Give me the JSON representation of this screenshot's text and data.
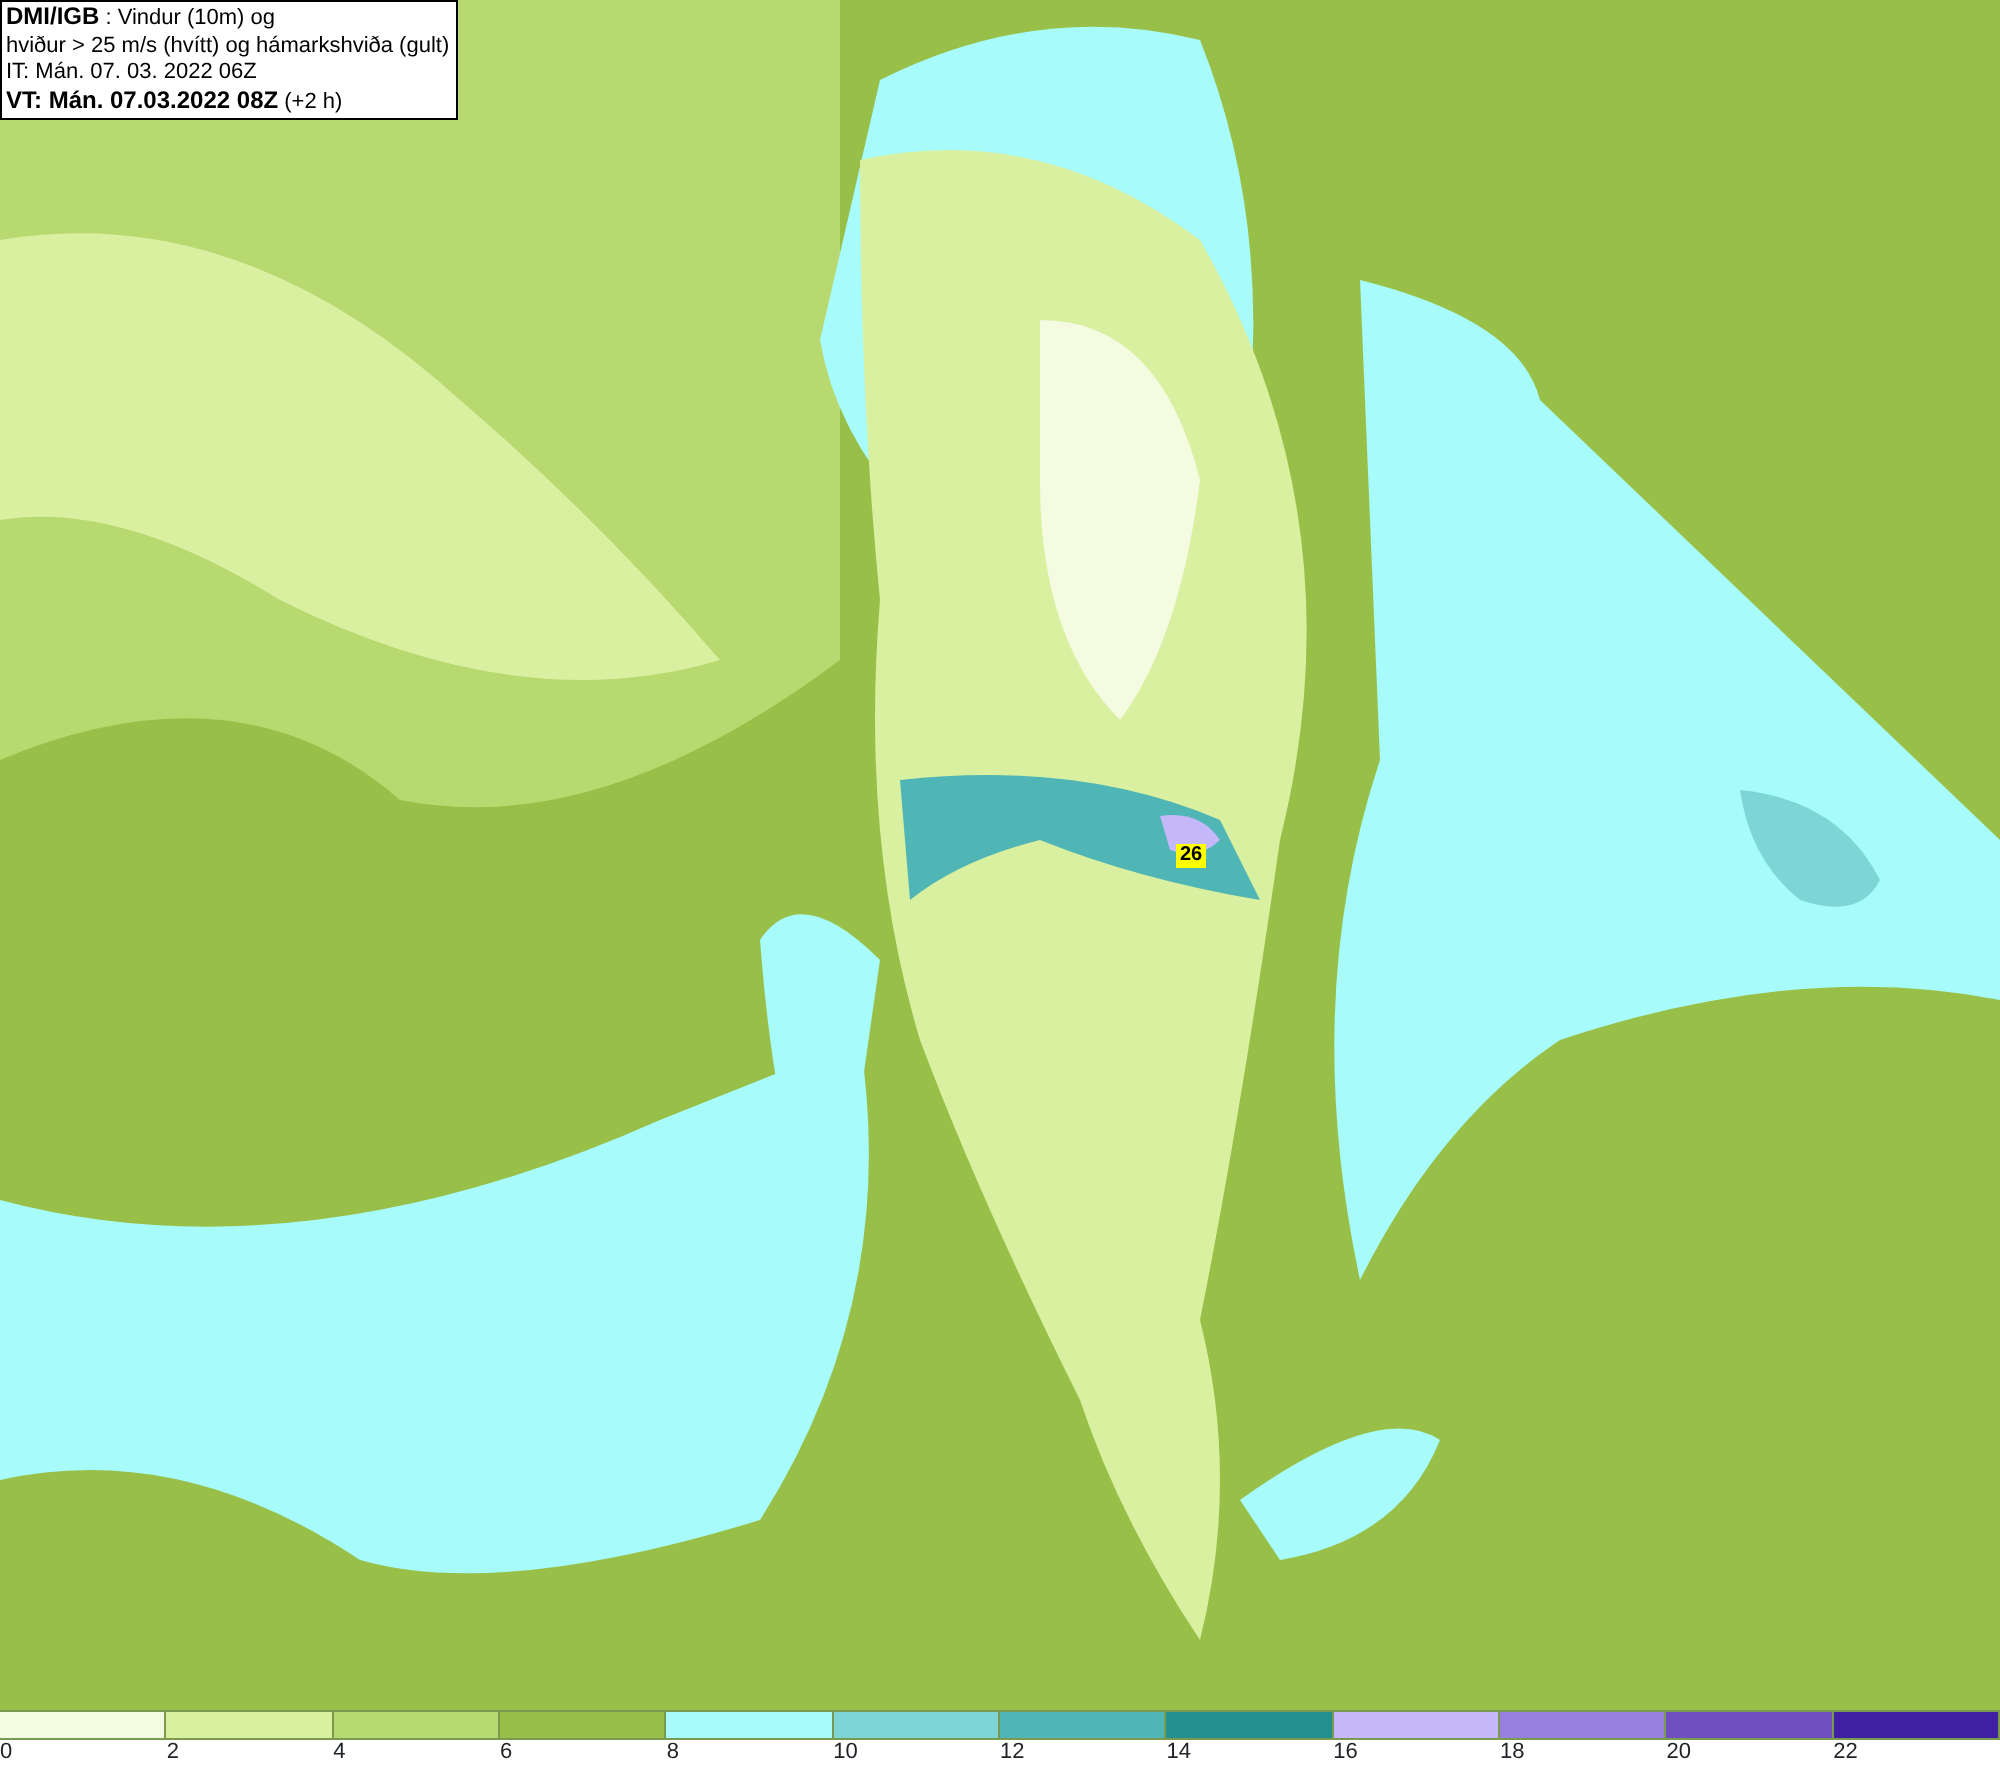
{
  "title_box": {
    "lines": [
      "**DMI/IGB** : Vindur (10m) og",
      "hviður > 25 m/s (hvítt) og hámarkshviða (gult)",
      "IT: Mán. 07. 03. 2022 06Z",
      "**VT: Mán. 07.03.2022 08Z** (+2 h)"
    ]
  },
  "map": {
    "gust_marker": "26"
  },
  "legend": {
    "bins": [
      {
        "label": "0",
        "color": "#f4fbe0"
      },
      {
        "label": "2",
        "color": "#d8f0a0"
      },
      {
        "label": "4",
        "color": "#b8d870"
      },
      {
        "label": "6",
        "color": "#98bf48"
      },
      {
        "label": "8",
        "color": "#a8fbfb"
      },
      {
        "label": "10",
        "color": "#7dd5d5"
      },
      {
        "label": "12",
        "color": "#4fb5b5"
      },
      {
        "label": "14",
        "color": "#22908e"
      },
      {
        "label": "16",
        "color": "#c4b8f8"
      },
      {
        "label": "18",
        "color": "#9880e0"
      },
      {
        "label": "20",
        "color": "#7050c0"
      },
      {
        "label": "22",
        "color": "#4020a0"
      }
    ]
  }
}
